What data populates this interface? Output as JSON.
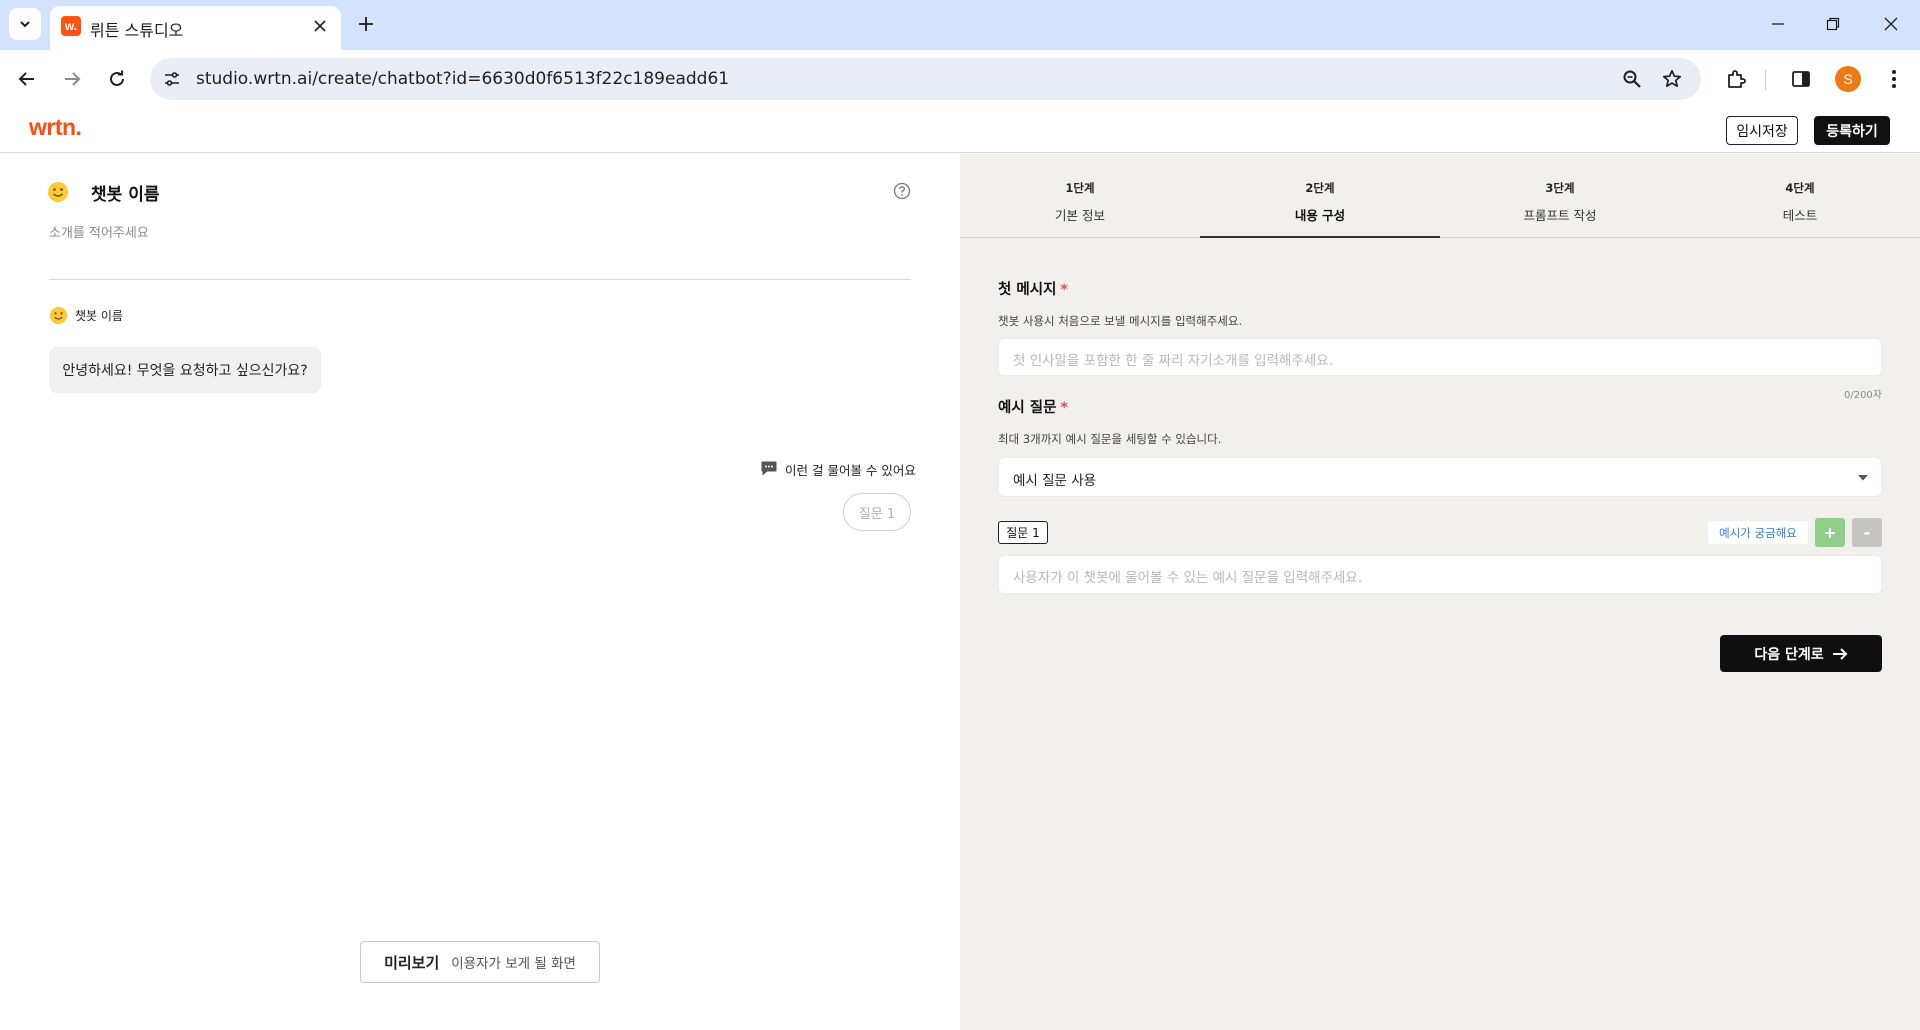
{
  "browser": {
    "tab_title": "뤼튼 스튜디오",
    "favicon_text": "w.",
    "url": "studio.wrtn.ai/create/chatbot?id=6630d0f6513f22c189eadd61",
    "profile_initial": "S"
  },
  "header": {
    "logo": "wrtn.",
    "save_label": "임시저장",
    "register_label": "등록하기"
  },
  "preview": {
    "bot_name": "챗봇 이름",
    "intro_placeholder": "소개를 적어주세요",
    "bot_name_small": "챗봇 이름",
    "greeting": "안녕하세요! 무엇을 요청하고 싶으신가요?",
    "ask_hint": "이런 걸 물어볼 수 있어요",
    "question_chip": "질문 1",
    "preview_label": "미리보기",
    "preview_desc": "이용자가 보게 될 화면"
  },
  "steps": [
    {
      "num": "1단계",
      "label": "기본 정보"
    },
    {
      "num": "2단계",
      "label": "내용 구성"
    },
    {
      "num": "3단계",
      "label": "프롬프트 작성"
    },
    {
      "num": "4단계",
      "label": "테스트"
    }
  ],
  "form": {
    "first_message": {
      "title": "첫 메시지",
      "required": "*",
      "desc": "챗봇 사용시 처음으로 보낼 메시지를 입력해주세요.",
      "placeholder": "첫 인사말을 포함한 한 줄 짜리 자기소개를 입력해주세요.",
      "counter": "0/200자"
    },
    "example_questions": {
      "title": "예시 질문",
      "required": "*",
      "desc": "최대 3개까지 예시 질문을 세팅할 수 있습니다.",
      "select_value": "예시 질문 사용",
      "question_badge": "질문 1",
      "example_link": "예시가 궁금해요",
      "add_label": "+",
      "remove_label": "-",
      "question_placeholder": "사용자가 이 챗봇에 물어볼 수 있는 예시 질문을 입력해주세요."
    },
    "next_label": "다음 단계로"
  },
  "colors": {
    "brand": "#ff4d12",
    "tabbar": "#d3e3fd",
    "right_panel_bg": "#f1f0ec",
    "required": "#f04a4a",
    "link": "#2f7be5",
    "add_green": "#8fcf8a"
  }
}
